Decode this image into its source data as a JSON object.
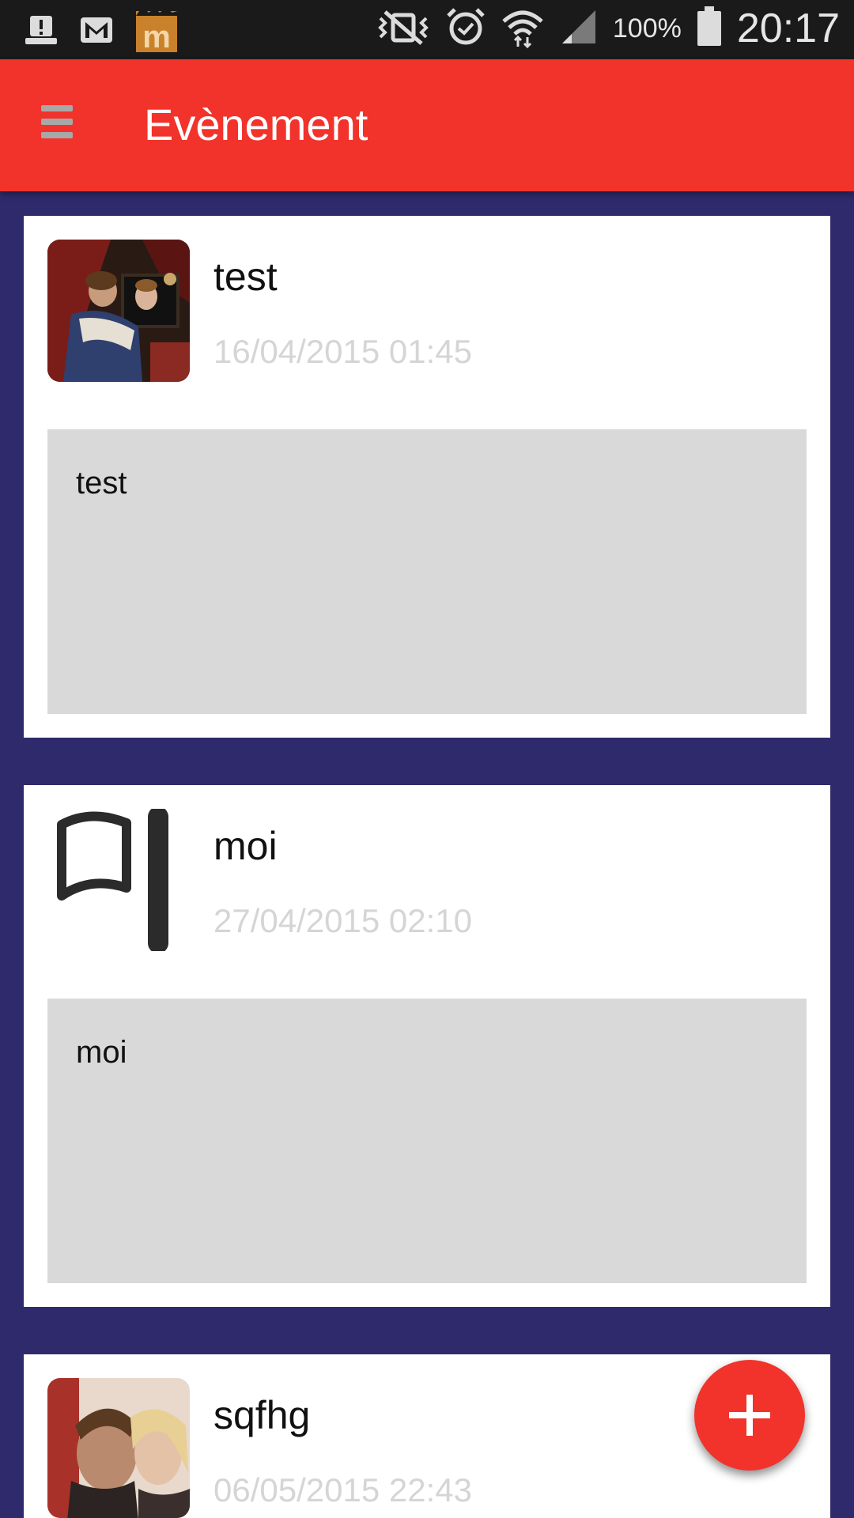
{
  "status_bar": {
    "battery_text": "100%",
    "time": "20:17",
    "left_icons": [
      "notification-icon",
      "gmail-icon",
      "app-m-icon"
    ],
    "right_icons": [
      "vibrate-mute-icon",
      "alarm-icon",
      "wifi-icon",
      "signal-icon",
      "battery-icon"
    ]
  },
  "app_bar": {
    "title": "Evènement",
    "menu_icon": "menu-icon",
    "color": "#f1332b"
  },
  "events": [
    {
      "title": "test",
      "date": "16/04/2015 01:45",
      "description": "test",
      "thumbnail": "painting-photo"
    },
    {
      "title": "moi",
      "date": "27/04/2015 02:10",
      "description": "moi",
      "thumbnail": "flag-icon"
    },
    {
      "title": "sqfhg",
      "date": "06/05/2015 22:43",
      "description": "",
      "thumbnail": "movie-poster-photo"
    }
  ],
  "fab": {
    "icon": "plus-icon"
  },
  "colors": {
    "background": "#2f2a6b",
    "accent": "#f1332b",
    "date_text": "#d5d5d5",
    "description_bg": "#d9d9d9"
  }
}
